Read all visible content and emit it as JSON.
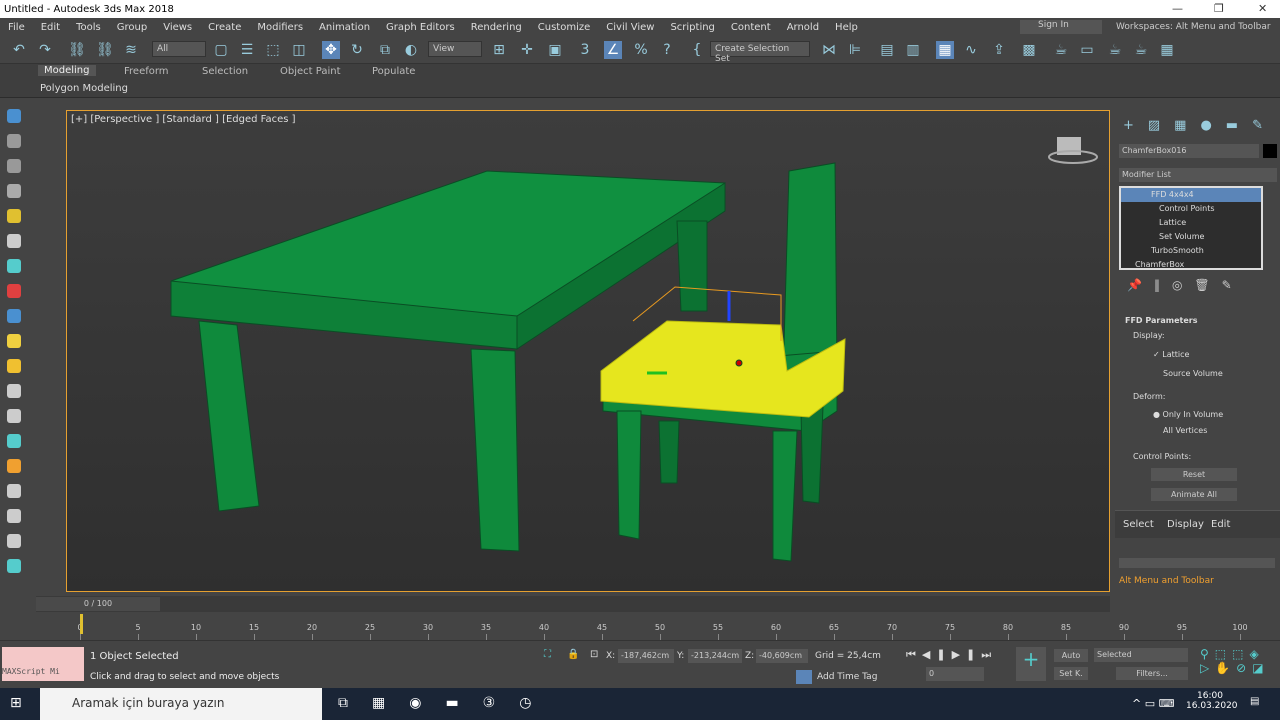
{
  "window": {
    "title": "Untitled - Autodesk 3ds Max 2018"
  },
  "menu": [
    "File",
    "Edit",
    "Tools",
    "Group",
    "Views",
    "Create",
    "Modifiers",
    "Animation",
    "Graph Editors",
    "Rendering",
    "Customize",
    "Civil View",
    "Scripting",
    "Content",
    "Arnold",
    "Help"
  ],
  "account": {
    "signin": "Sign In",
    "workspaces": "Workspaces: Alt Menu and Toolbar"
  },
  "toolbar": {
    "filter": "All",
    "refcoord": "View",
    "selset": "Create Selection Set"
  },
  "ribbon": {
    "tabs": [
      "Modeling",
      "Freeform",
      "Selection",
      "Object Paint",
      "Populate"
    ],
    "active": "Modeling",
    "panel": "Polygon Modeling"
  },
  "viewport": {
    "label": "[+] [Perspective ] [Standard ] [Edged Faces ]"
  },
  "command_panel": {
    "object_name": "ChamferBox016",
    "object_color": "#000000",
    "modifier_list": "Modifier List",
    "stack": [
      {
        "label": "FFD 4x4x4",
        "selected": true
      },
      {
        "label": "Control Points"
      },
      {
        "label": "Lattice"
      },
      {
        "label": "Set Volume"
      },
      {
        "label": "TurboSmooth"
      },
      {
        "label": "ChamferBox"
      }
    ],
    "rollout_title": "FFD Parameters",
    "display_label": "Display:",
    "lattice": "Lattice",
    "lattice_checked": true,
    "source_volume": "Source Volume",
    "deform_label": "Deform:",
    "only_in_volume": "Only In Volume",
    "all_vertices": "All Vertices",
    "control_points_label": "Control Points:",
    "reset": "Reset",
    "animate_all": "Animate All",
    "tabs": [
      "Select",
      "Display",
      "Edit"
    ],
    "workspace_label": "Alt Menu and Toolbar"
  },
  "timeline": {
    "frame": "0 / 100",
    "ticks": [
      0,
      5,
      10,
      15,
      20,
      25,
      30,
      35,
      40,
      45,
      50,
      55,
      60,
      65,
      70,
      75,
      80,
      85,
      90,
      95,
      100
    ]
  },
  "status": {
    "maxscript": "MAXScript Mi",
    "selected": "1 Object Selected",
    "prompt": "Click and drag to select and move objects",
    "x": "-187,462cm",
    "y": "-213,244cm",
    "z": "-40,609cm",
    "grid": "Grid = 25,4cm",
    "add_time_tag": "Add Time Tag",
    "frame_field": "0",
    "auto": "Auto",
    "setkey": "Set K.",
    "key_filter": "Selected",
    "filters": "Filters..."
  },
  "taskbar": {
    "search": "Aramak için buraya yazın",
    "time": "16:00",
    "date": "16.03.2020"
  }
}
